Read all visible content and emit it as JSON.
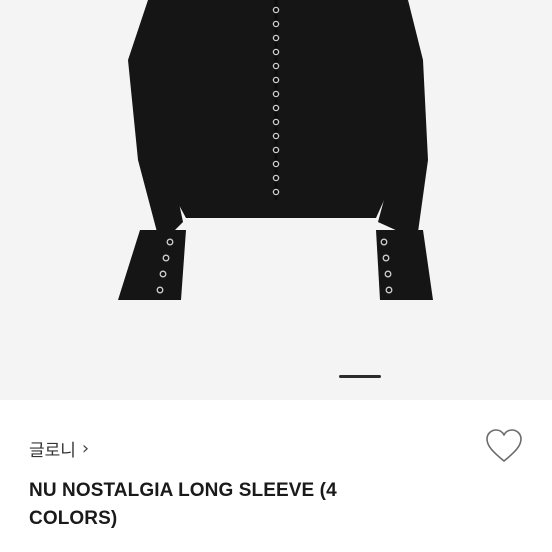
{
  "product": {
    "image_icon": "product-photo-black-long-sleeve",
    "carousel": {
      "active_index": 1
    },
    "brand": {
      "name": "글로니",
      "chevron": "›"
    },
    "wishlist_icon": "heart-outline-icon",
    "title": "NU NOSTALGIA LONG SLEEVE (4 COLORS)"
  },
  "colors": {
    "garment": "#151515",
    "background": "#f4f4f4",
    "snap": "#c9c9c9"
  }
}
